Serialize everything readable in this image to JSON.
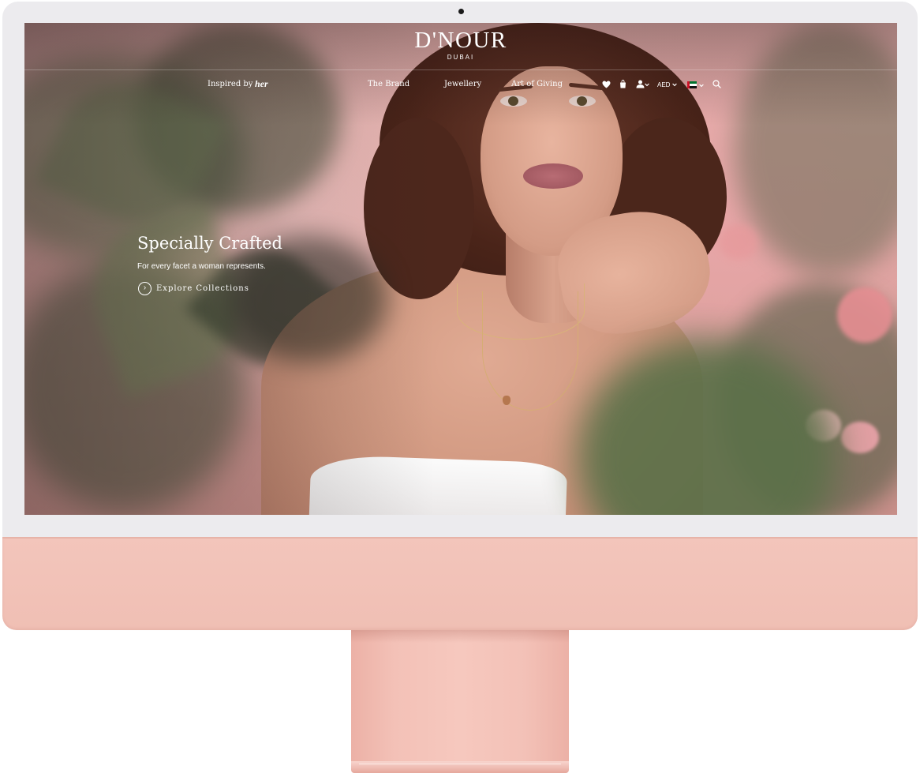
{
  "brand": {
    "name": "D'NOUR",
    "location": "DUBAI"
  },
  "nav": {
    "inspired_by": "Inspired by",
    "inspired_signature": "her",
    "items": [
      {
        "label": "The Brand"
      },
      {
        "label": "Jewellery"
      },
      {
        "label": "Art of Giving"
      }
    ],
    "currency": "AED",
    "icons": [
      "heart-icon",
      "shopping-bag-icon",
      "user-icon",
      "chevron-down-icon",
      "uae-flag-icon",
      "search-icon"
    ]
  },
  "hero": {
    "title": "Specially Crafted",
    "subtitle": "For every facet a woman represents.",
    "cta": "Explore Collections"
  },
  "colors": {
    "device_body": "#f2c3b9",
    "bezel": "#ecebee",
    "text": "#ffffff"
  }
}
